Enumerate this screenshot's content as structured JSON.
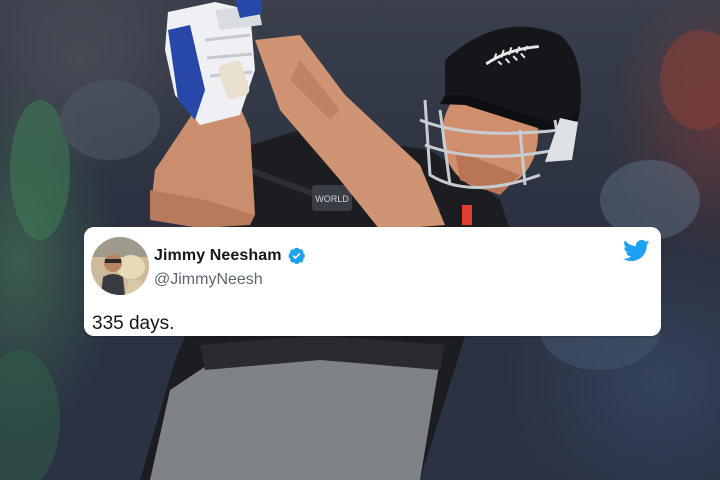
{
  "tweet": {
    "display_name": "Jimmy Neesham",
    "handle": "@JimmyNeesh",
    "text": "335 days.",
    "verified": true,
    "brand_color": "#1da1f2"
  },
  "photo": {
    "subject": "cricket batsman in black kit and helmet mid-swing",
    "helmet_emblem": "silver-fern-icon",
    "kit_colors": [
      "#1b1c1f",
      "#7c7f82",
      "#e03c31"
    ]
  },
  "icons": {
    "verified": "verified-badge-icon",
    "brand": "twitter-bird-icon"
  }
}
